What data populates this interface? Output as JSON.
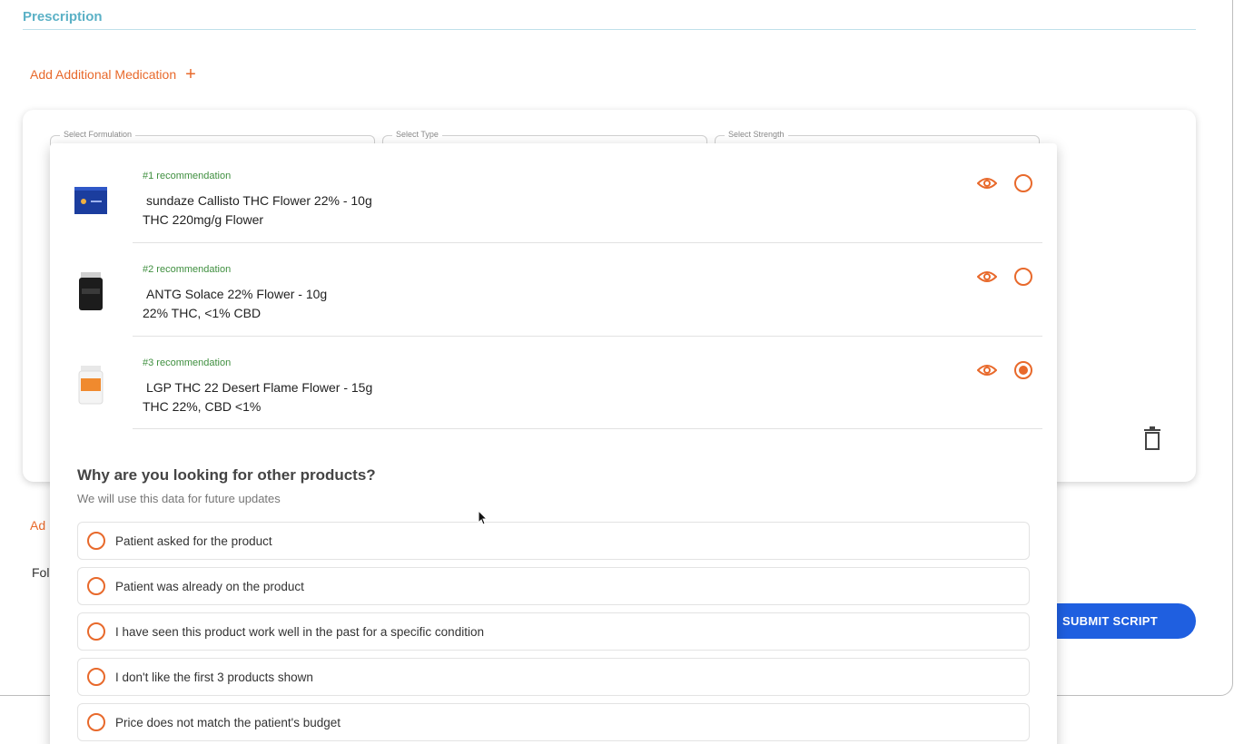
{
  "section": {
    "title": "Prescription"
  },
  "actions": {
    "add_additional_medication": "Add Additional Medication",
    "add_below_partial": "Ad",
    "submit_label": "SUBMIT SCRIPT"
  },
  "form": {
    "select_formulation_label": "Select Formulation",
    "select_type_label": "Select Type",
    "select_strength_label": "Select Strength",
    "follow_label_partial": "Fol"
  },
  "recommendations": [
    {
      "rank": "#1 recommendation",
      "name": "sundaze Callisto THC Flower 22% - 10g",
      "detail": "THC 220mg/g Flower",
      "selected": false
    },
    {
      "rank": "#2 recommendation",
      "name": "ANTG Solace 22% Flower - 10g",
      "detail": "22% THC, <1% CBD",
      "selected": false
    },
    {
      "rank": "#3 recommendation",
      "name": "LGP THC 22 Desert Flame Flower - 15g",
      "detail": "THC 22%, CBD <1%",
      "selected": true
    }
  ],
  "why": {
    "title": "Why are you looking for other products?",
    "subtitle": "We will use this data for future updates",
    "reasons": [
      "Patient asked for the product",
      "Patient was already on the product",
      "I have seen this product work well in the past for a specific condition",
      "I don't like the first 3 products shown",
      "Price does not match the patient's budget"
    ]
  },
  "colors": {
    "accent": "#e8692b",
    "title": "#5bb1c6",
    "rank": "#3f8f3f",
    "primary_button": "#1f5fe0"
  }
}
